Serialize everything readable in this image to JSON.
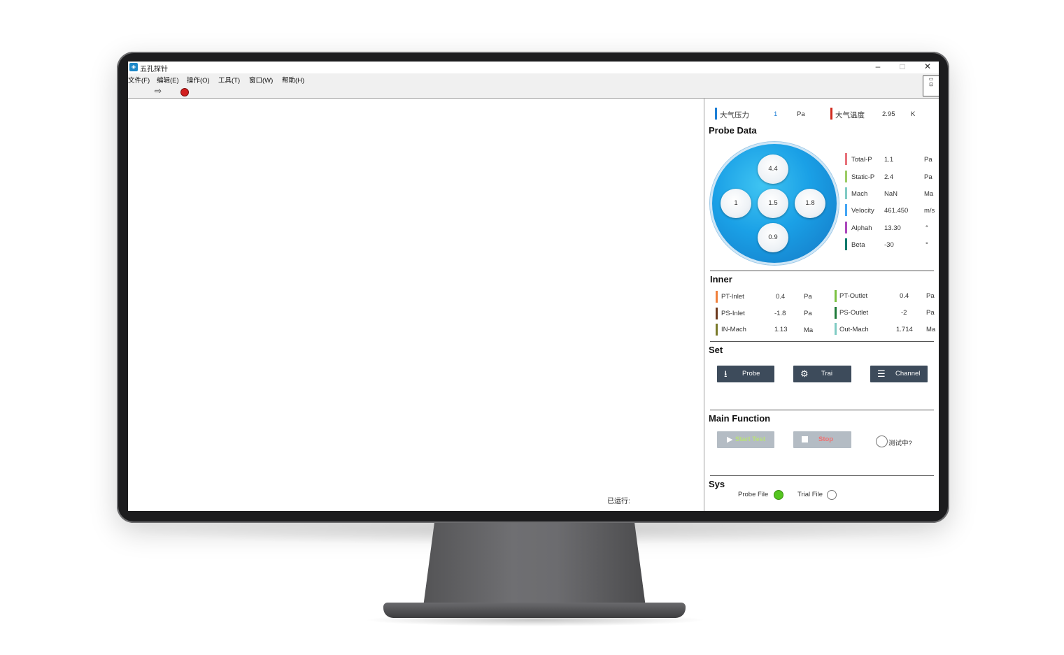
{
  "window": {
    "title": "五孔探针",
    "minimize": "–",
    "maximize": "□",
    "close": "✕"
  },
  "menu": [
    "文件(F)",
    "编辑(E)",
    "操作(O)",
    "工具(T)",
    "窗口(W)",
    "帮助(H)"
  ],
  "status": {
    "runtime_label": "已运行:"
  },
  "atmosphere": {
    "pressure": {
      "label": "大气压力",
      "value": "1",
      "unit": "Pa",
      "color": "#1e7fd6"
    },
    "temperature": {
      "label": "大气温度",
      "value": "2.95",
      "unit": "K",
      "color": "#d02a1e"
    }
  },
  "probe": {
    "title": "Probe Data",
    "holes": {
      "top": "4.4",
      "left": "1",
      "center": "1.5",
      "right": "1.8",
      "bottom": "0.9"
    },
    "readings": [
      {
        "label": "Total-P",
        "value": "1.1",
        "unit": "Pa",
        "color": "#e7717a"
      },
      {
        "label": "Static-P",
        "value": "2.4",
        "unit": "Pa",
        "color": "#9ccc65"
      },
      {
        "label": "Mach",
        "value": "NaN",
        "unit": "Ma",
        "color": "#80cbc4"
      },
      {
        "label": "Velocity",
        "value": "461.450",
        "unit": "m/s",
        "color": "#42a5f5"
      },
      {
        "label": "Alphah",
        "value": "13.30",
        "unit": "°",
        "color": "#ab47bc"
      },
      {
        "label": "Beta",
        "value": "-30",
        "unit": "°",
        "color": "#00796b"
      }
    ]
  },
  "inner": {
    "title": "Inner",
    "left": [
      {
        "label": "PT-Inlet",
        "value": "0.4",
        "unit": "Pa",
        "color": "#f0803c"
      },
      {
        "label": "PS-Inlet",
        "value": "-1.8",
        "unit": "Pa",
        "color": "#6d3a1e"
      },
      {
        "label": "IN-Mach",
        "value": "1.13",
        "unit": "Ma",
        "color": "#7a7a2a"
      }
    ],
    "right": [
      {
        "label": "PT-Outlet",
        "value": "0.4",
        "unit": "Pa",
        "color": "#7cc242"
      },
      {
        "label": "PS-Outlet",
        "value": "-2",
        "unit": "Pa",
        "color": "#1f7a3a"
      },
      {
        "label": "Out-Mach",
        "value": "1.714",
        "unit": "Ma",
        "color": "#80cbc4"
      }
    ]
  },
  "set": {
    "title": "Set",
    "buttons": [
      {
        "label": "Probe",
        "icon": "download-icon"
      },
      {
        "label": "Trai",
        "icon": "gear-icon"
      },
      {
        "label": "Channel",
        "icon": "sliders-icon"
      }
    ]
  },
  "main": {
    "title": "Main Function",
    "start": "Start  Test",
    "stop": "Stop",
    "testing": "测试中?"
  },
  "sys": {
    "title": "Sys",
    "probe_file": "Probe File",
    "trial_file": "Trial File"
  }
}
